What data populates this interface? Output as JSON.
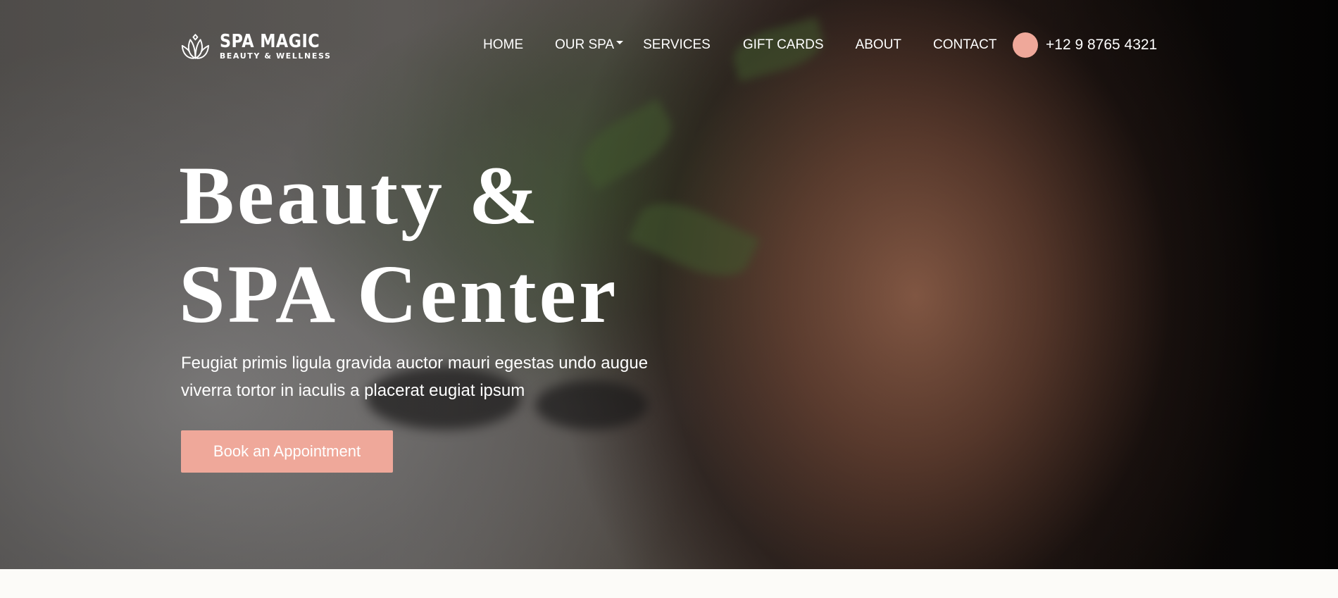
{
  "brand": {
    "name": "SPA MAGIC",
    "tagline": "BEAUTY & WELLNESS",
    "logo_icon": "lotus-icon"
  },
  "nav": {
    "items": [
      {
        "label": "HOME"
      },
      {
        "label": "OUR SPA",
        "has_dropdown": true
      },
      {
        "label": "SERVICES"
      },
      {
        "label": "GIFT CARDS"
      },
      {
        "label": "ABOUT"
      },
      {
        "label": "CONTACT"
      }
    ],
    "phone": "+12 9 8765 4321",
    "phone_icon": "phone-icon"
  },
  "hero": {
    "title_line1": "Beauty &",
    "title_line2": "SPA Center",
    "subtitle": "Feugiat primis ligula gravida auctor mauri egestas undo augue viverra tortor in iaculis a placerat eugiat ipsum",
    "cta_label": "Book an Appointment"
  },
  "colors": {
    "accent": "#efa89a",
    "text_light": "#ffffff",
    "page_bg": "#fcfbf8"
  }
}
